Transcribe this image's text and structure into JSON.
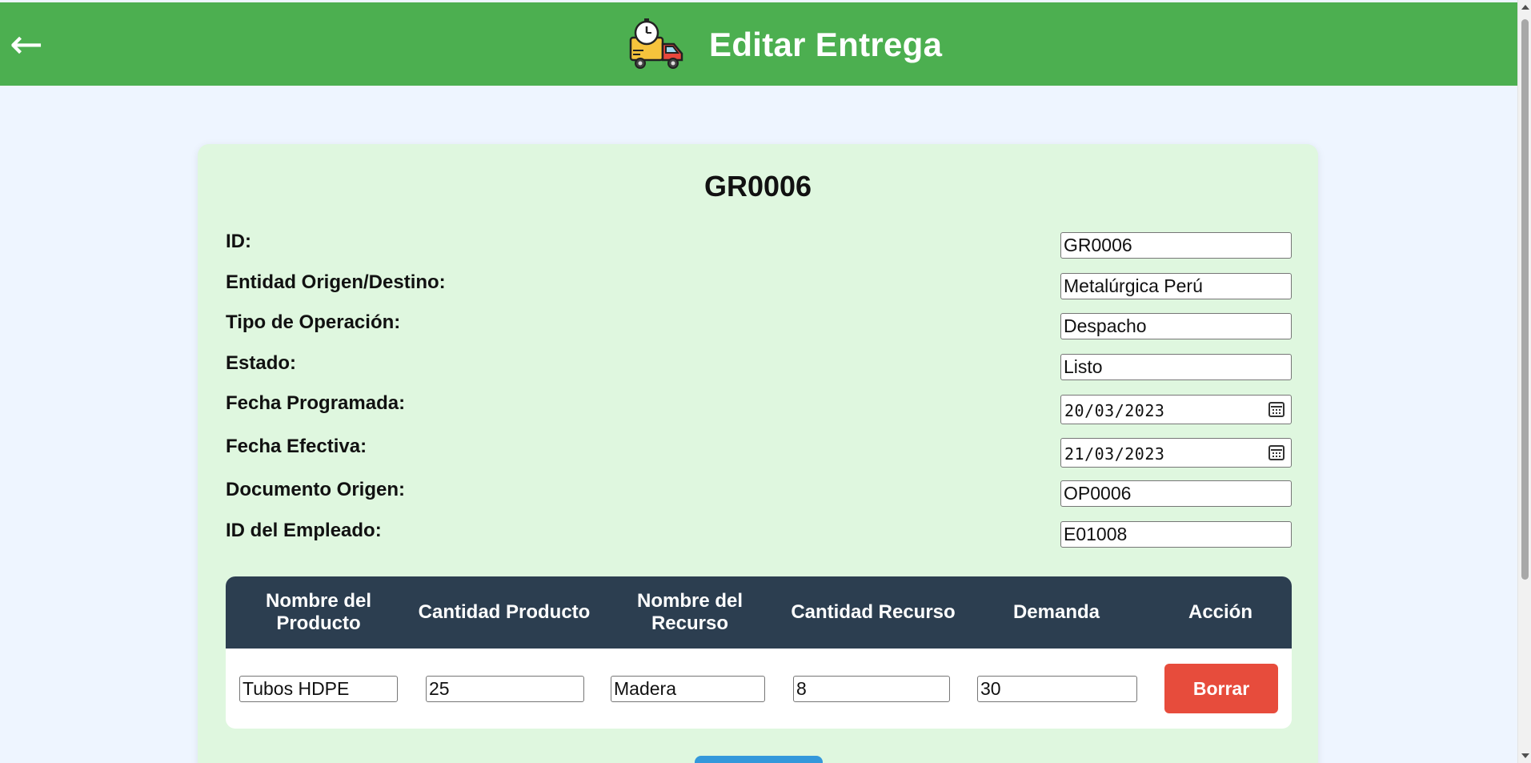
{
  "header": {
    "back_symbol": "←",
    "title": "Editar Entrega",
    "icon": "delivery-truck-stopwatch-icon"
  },
  "record": {
    "title": "GR0006",
    "fields": [
      {
        "label": "ID:",
        "value": "GR0006",
        "type": "text"
      },
      {
        "label": "Entidad Origen/Destino:",
        "value": "Metalúrgica Perú",
        "type": "text"
      },
      {
        "label": "Tipo de Operación:",
        "value": "Despacho",
        "type": "text"
      },
      {
        "label": "Estado:",
        "value": "Listo",
        "type": "text"
      },
      {
        "label": "Fecha Programada:",
        "value": "20/03/2023",
        "type": "date"
      },
      {
        "label": "Fecha Efectiva:",
        "value": "21/03/2023",
        "type": "date"
      },
      {
        "label": "Documento Origen:",
        "value": "OP0006",
        "type": "text"
      },
      {
        "label": "ID del Empleado:",
        "value": "E01008",
        "type": "text"
      }
    ]
  },
  "table": {
    "headers": [
      "Nombre del Producto",
      "Cantidad Producto",
      "Nombre del Recurso",
      "Cantidad Recurso",
      "Demanda",
      "Acción"
    ],
    "rows": [
      {
        "producto": "Tubos HDPE",
        "cantidad_producto": "25",
        "recurso": "Madera",
        "cantidad_recurso": "8",
        "demanda": "30",
        "action_label": "Borrar"
      }
    ]
  },
  "colors": {
    "header_bg": "#4caf50",
    "card_bg": "#dff7df",
    "table_head_bg": "#2c3e50",
    "delete_bg": "#e74c3c",
    "save_bg": "#3498db"
  }
}
